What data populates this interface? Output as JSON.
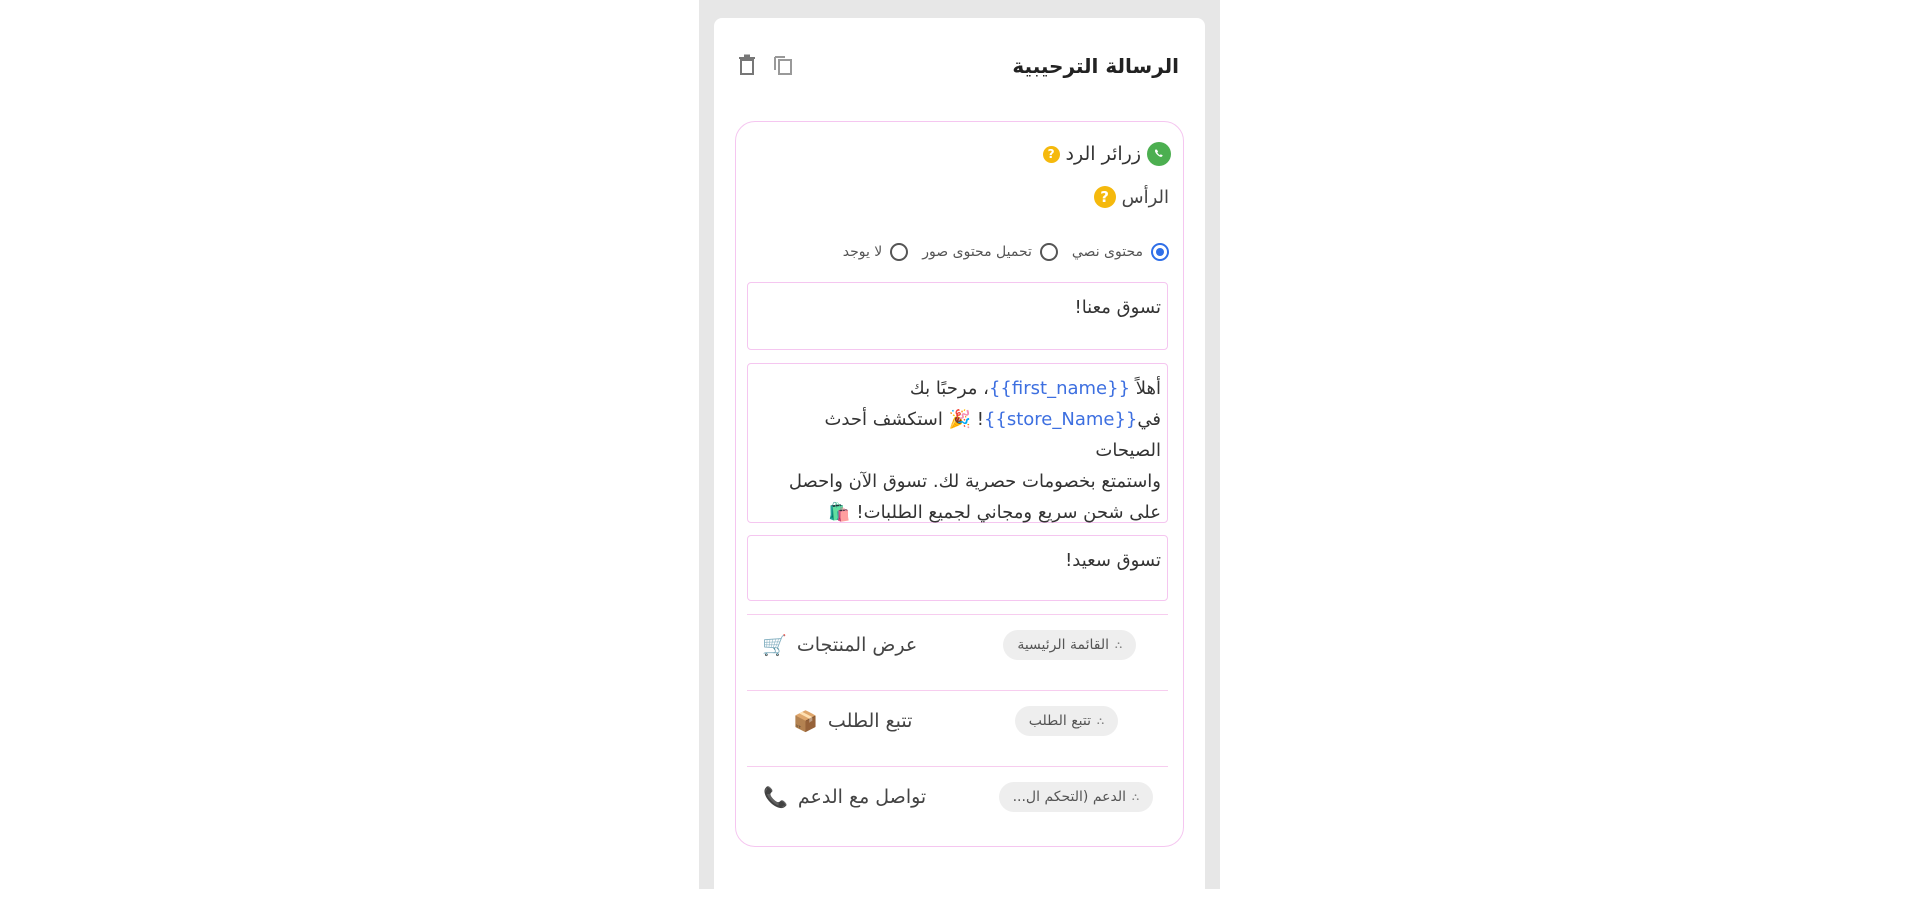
{
  "card": {
    "title": "الرسالة الترحيبية"
  },
  "reply_buttons": {
    "title": "زرائر الرد",
    "help": "?"
  },
  "header": {
    "label": "الرأس",
    "help": "?"
  },
  "header_type": {
    "options": [
      {
        "label": "محتوى نصي",
        "selected": true
      },
      {
        "label": "تحميل محتوى صور",
        "selected": false
      },
      {
        "label": "لا يوجد",
        "selected": false
      }
    ]
  },
  "header_text": "تسوق معنا!",
  "body": {
    "l1_a": "أهلاً ",
    "l1_var": "{{first_name}}",
    "l1_b": "، مرحبًا بك",
    "l2_a": "في",
    "l2_var": "{{store_Name}}",
    "l2_b": "! 🎉 استكشف أحدث الصيحات",
    "l3": "واستمتع بخصومات حصرية لك. تسوق الآن واحصل",
    "l4": "على شحن سريع ومجاني لجميع الطلبات! 🛍️"
  },
  "footer_text": "تسوق سعيد!",
  "buttons": [
    {
      "chip": "القائمة الرئيسية",
      "label": "عرض المنتجات",
      "emoji": "🛒"
    },
    {
      "chip": "تتبع الطلب",
      "label": "تتبع الطلب",
      "emoji": "📦"
    },
    {
      "chip": "الدعم (التحكم ال...",
      "label": "تواصل مع الدعم",
      "emoji": "📞"
    }
  ],
  "colors": {
    "accent": "#2f6fe8",
    "border": "#f5c6f0",
    "help": "#f5b90d",
    "whatsapp": "#4caf50"
  }
}
